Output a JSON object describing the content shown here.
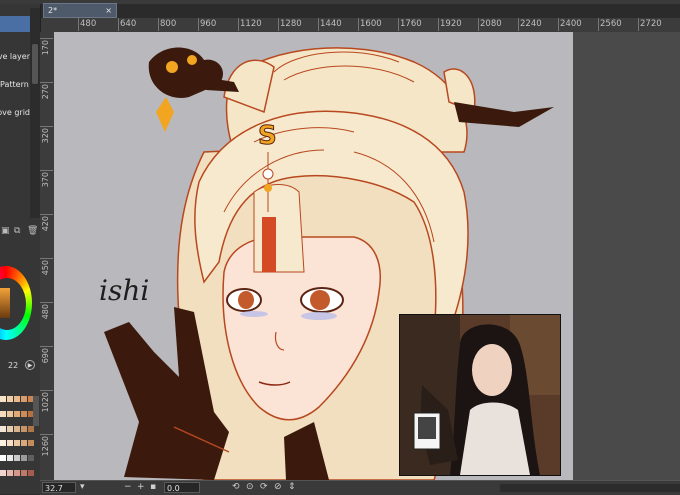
{
  "document_tab": {
    "title": "2*",
    "close_glyph": "×"
  },
  "ruler_h": [
    "480",
    "640",
    "800",
    "960",
    "1120",
    "1280",
    "1440",
    "1600",
    "1760",
    "1920",
    "2080",
    "2240",
    "2400",
    "2560",
    "2720"
  ],
  "ruler_v": [
    "170",
    "270",
    "320",
    "370",
    "420",
    "450",
    "480",
    "690",
    "1020",
    "1260"
  ],
  "left_panel": {
    "buttons": [
      "Move layer",
      "Pattern",
      "Move grid"
    ],
    "layer_icons": [
      "new-layer-icon",
      "copy-layer-icon",
      "delete-layer-icon"
    ],
    "brush_size": "22",
    "swatches": [
      "#f7e3c8",
      "#f0cfa8",
      "#e8b98a",
      "#d89d6a",
      "#c98452",
      "#f5dcbf",
      "#ecc79e",
      "#e0aa78",
      "#cc8b57",
      "#b8703f",
      "#f4e6d6",
      "#e6cdb1",
      "#d8b28c",
      "#c59567",
      "#ab7748",
      "#fff1e2",
      "#f6dfc6",
      "#e9c7a2",
      "#d7aa7e",
      "#c38c5c",
      "#ffffff",
      "#e8e8e8",
      "#c9c9c9",
      "#9b9b9b",
      "#5e5e5e",
      "#f3d5d0",
      "#e6b6ad",
      "#d5978a",
      "#c07868",
      "#a65c4c"
    ]
  },
  "artwork": {
    "signature": "ishi",
    "hairpin_letter": "S"
  },
  "bottom_bar": {
    "zoom": "32.7",
    "angle": "0.0"
  },
  "colors": {
    "canvas_bg": "#b9b8bc",
    "hair": "#f5e6c7",
    "lineart": "#b8481f",
    "dark_brown": "#3b1a0d",
    "gold": "#f1a520"
  }
}
